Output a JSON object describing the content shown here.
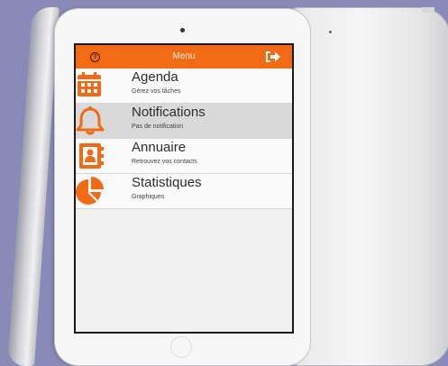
{
  "header": {
    "title": "Menu",
    "help_icon": "question-circle-icon",
    "logout_icon": "sign-out-icon"
  },
  "menu": {
    "items": [
      {
        "title": "Agenda",
        "subtitle": "Gérez vos tâches",
        "icon": "calendar-icon",
        "selected": false
      },
      {
        "title": "Notifications",
        "subtitle": "Pas de notification",
        "icon": "bell-icon",
        "selected": true
      },
      {
        "title": "Annuaire",
        "subtitle": "Retrouvez vos contacts",
        "icon": "contact-book-icon",
        "selected": false
      },
      {
        "title": "Statistiques",
        "subtitle": "Graphiques",
        "icon": "pie-chart-icon",
        "selected": false
      }
    ]
  },
  "colors": {
    "accent": "#f26a13",
    "selected_row": "#d9d9d9",
    "background": "#8a8ab8"
  }
}
